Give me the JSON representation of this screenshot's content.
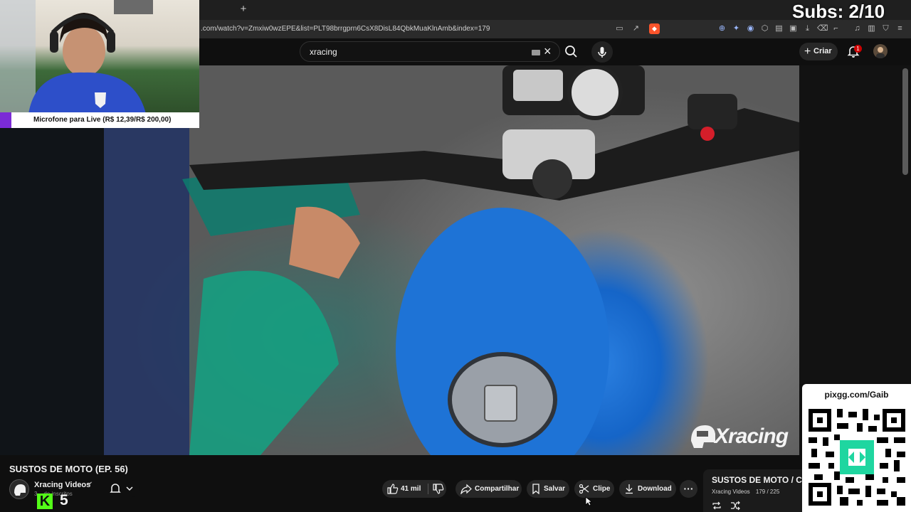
{
  "browser": {
    "new_tab_glyph": "+",
    "url": ".com/watch?v=Zmxiw0wzEPE&list=PLT98brrgprn6CsX8DisL84QbkMuaKlnAmb&index=179",
    "extension_icons": [
      "cast-icon",
      "share-icon",
      "brave-shield-icon",
      "translate-icon",
      "puzzle-icon",
      "list-icon",
      "download-icon",
      "trash-icon",
      "settings-icon"
    ]
  },
  "youtube": {
    "search": {
      "value": "xracing"
    },
    "create_label": "Criar",
    "notifications_count": "1"
  },
  "video": {
    "title": "SUSTOS DE MOTO (EP. 56)",
    "watermark": "Xracing"
  },
  "channel": {
    "name": "Xracing Videos",
    "subscribers": "3... de inscritos"
  },
  "actions": {
    "likes": "41 mil",
    "share": "Compartilhar",
    "save": "Salvar",
    "clip": "Clipe",
    "download": "Download",
    "more": "···"
  },
  "playlist": {
    "title": "SUSTOS DE MOTO / C",
    "channel": "Xracing Videos",
    "position": "179 / 225"
  },
  "overlays": {
    "donation": "Microfone para Live (R$ 12,39/R$ 200,00)",
    "subs_counter": "Subs: 2/10",
    "pix_link": "pixgg.com/Gaib",
    "kick_logo": "K",
    "kick_count": "5"
  },
  "colors": {
    "bg": "#0f0f0f",
    "pill": "#272727",
    "kick": "#53fc18",
    "donation_accent": "#7b2bd6",
    "yt_red": "#cc0000"
  }
}
